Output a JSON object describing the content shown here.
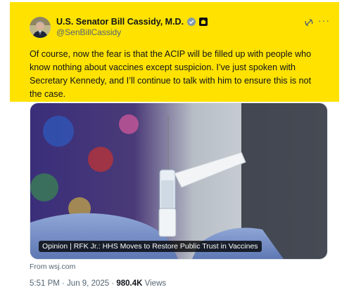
{
  "author": {
    "name": "U.S. Senator Bill Cassidy, M.D.",
    "handle": "@SenBillCassidy"
  },
  "tweet": {
    "text_lines": [
      "Of course, now the fear is that the ACIP will be filled up with people who",
      "know nothing about vaccines except suspicion. I’ve just spoken with",
      "Secretary Kennedy, and I’ll continue to talk with him to ensure this is not",
      "the case."
    ]
  },
  "card": {
    "caption": "Opinion | RFK Jr.: HHS Moves to Restore Public Trust in Vaccines",
    "source": "From wsj.com"
  },
  "meta": {
    "time": "5:51 PM · Jun 9, 2025 · ",
    "views_count": "980.4K",
    "views_label": " Views"
  },
  "colors": {
    "highlight": "#ffe200",
    "verified": "#829aab"
  },
  "icons": [
    "verified-badge-icon",
    "affiliation-badge-icon",
    "grok-icon",
    "more-icon"
  ]
}
